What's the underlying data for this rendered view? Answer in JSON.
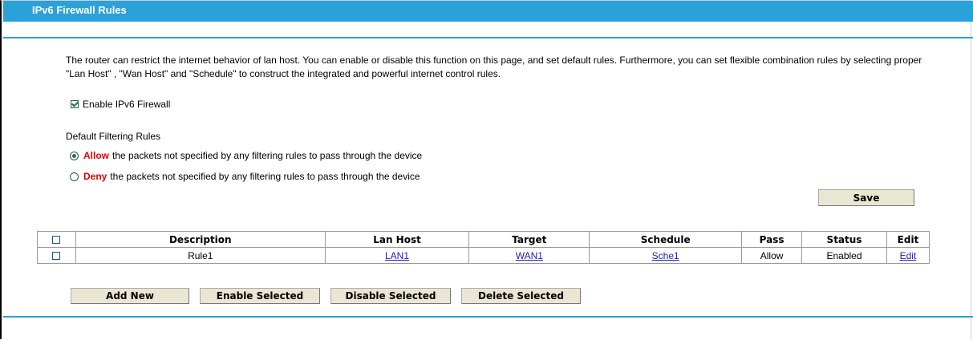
{
  "header": {
    "title": "IPv6 Firewall Rules"
  },
  "intro": {
    "text": "The router can restrict the internet behavior of lan host. You can enable or disable this function on this page, and set default rules. Furthermore, you can set flexible combination rules by selecting proper \"Lan Host\" , \"Wan Host\" and \"Schedule\" to construct the integrated and powerful internet control rules."
  },
  "enable_firewall": {
    "label": "Enable IPv6 Firewall",
    "checked": true
  },
  "default_rules": {
    "label": "Default Filtering Rules",
    "allow": {
      "keyword": "Allow",
      "text": "the packets not specified by any filtering rules to pass through the device",
      "selected": true
    },
    "deny": {
      "keyword": "Deny",
      "text": "the packets not specified by any filtering rules to pass through the device",
      "selected": false
    }
  },
  "save_label": "Save",
  "table": {
    "columns": [
      "Description",
      "Lan Host",
      "Target",
      "Schedule",
      "Pass",
      "Status",
      "Edit"
    ],
    "rows": [
      {
        "description": "Rule1",
        "lan_host": "LAN1",
        "target": "WAN1",
        "schedule": "Sche1",
        "pass": "Allow",
        "status": "Enabled",
        "edit": "Edit"
      }
    ]
  },
  "actions": {
    "add_new": "Add New",
    "enable_selected": "Enable Selected",
    "disable_selected": "Disable Selected",
    "delete_selected": "Delete Selected"
  },
  "colors": {
    "accent": "#2aa1d9",
    "keyword": "#e00000",
    "link": "#1b1bbf",
    "button_bg": "#eae6d4"
  }
}
